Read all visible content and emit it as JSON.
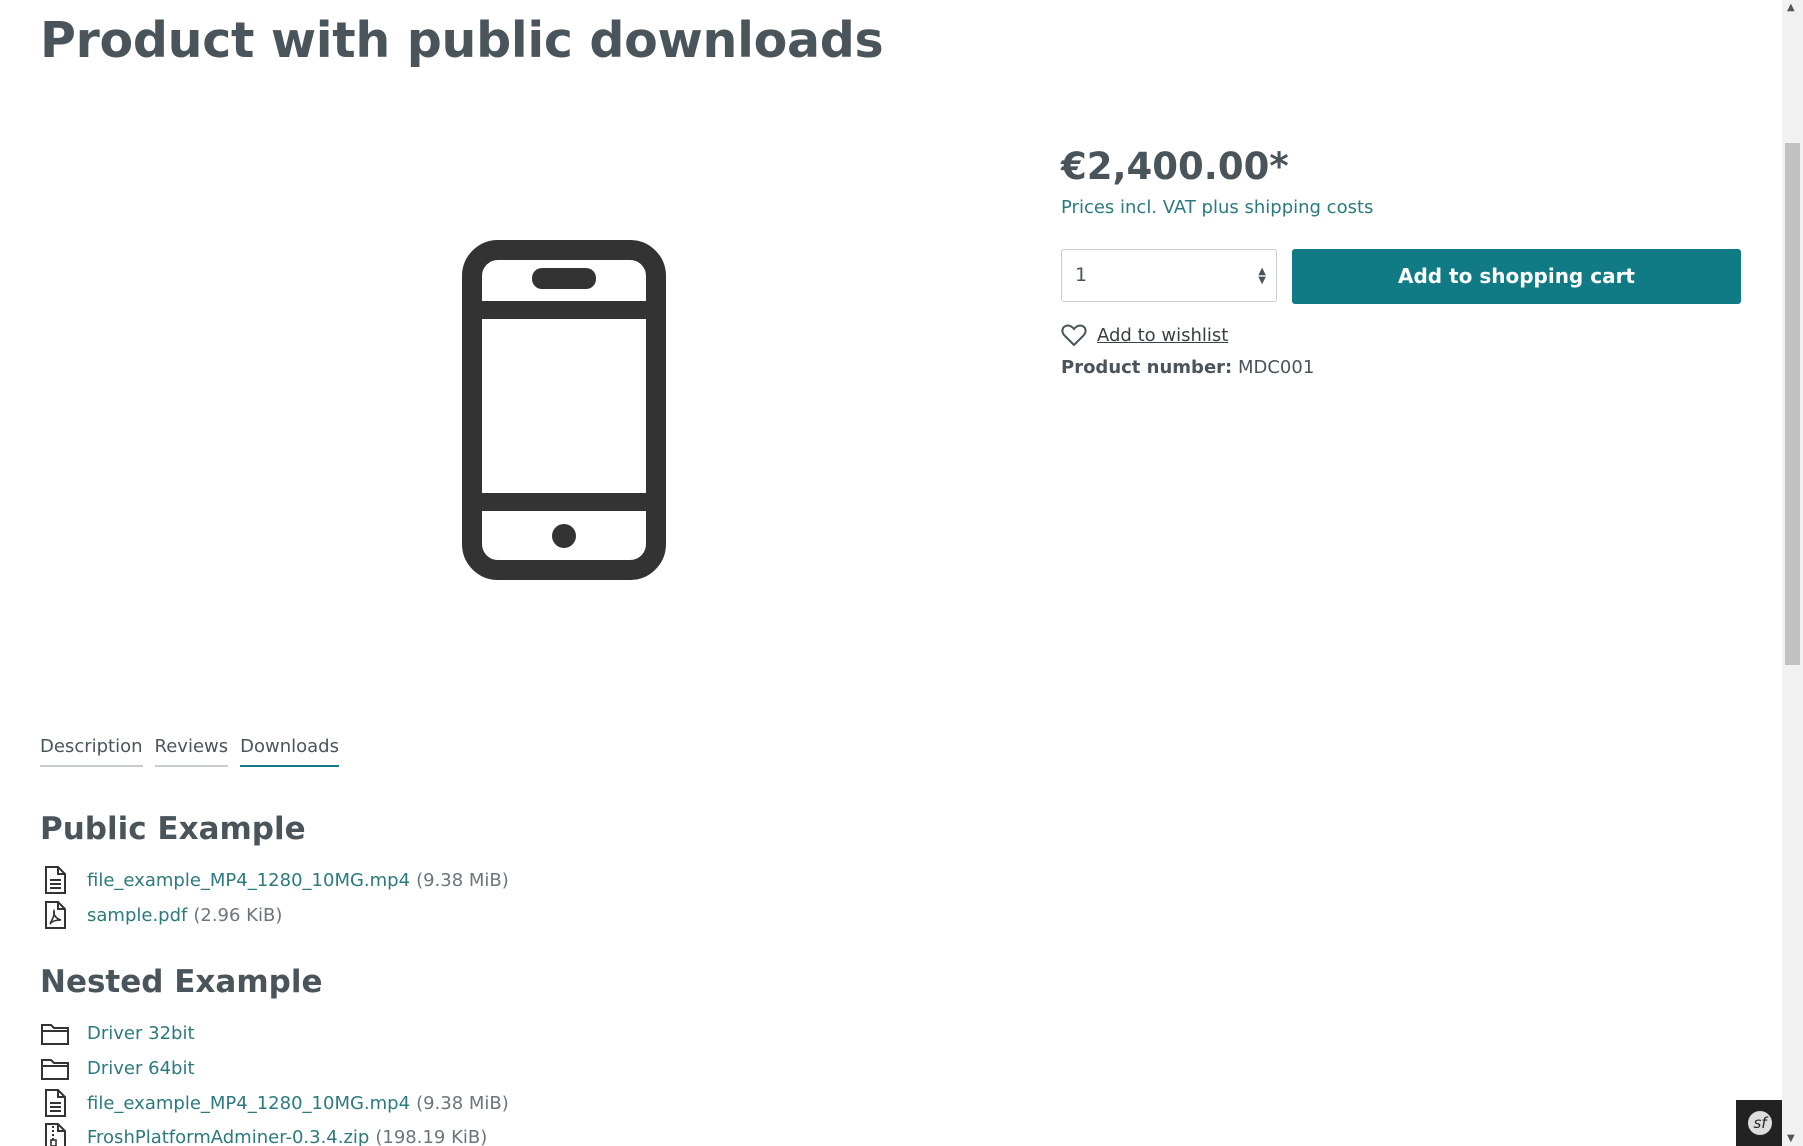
{
  "product": {
    "title": "Product with public downloads",
    "image_icon": "smartphone-icon"
  },
  "buybox": {
    "price": "€2,400.00*",
    "tax_note": "Prices incl. VAT plus shipping costs",
    "quantity": "1",
    "add_to_cart": "Add to shopping cart",
    "wishlist": "Add to wishlist",
    "product_number_label": "Product number:",
    "product_number": "MDC001"
  },
  "tabs": [
    {
      "label": "Description",
      "active": false
    },
    {
      "label": "Reviews",
      "active": false
    },
    {
      "label": "Downloads",
      "active": true
    }
  ],
  "downloads": {
    "public": {
      "heading": "Public Example",
      "items": [
        {
          "icon": "document-icon",
          "name": "file_example_MP4_1280_10MG.mp4",
          "size": "(9.38 MiB)"
        },
        {
          "icon": "pdf-file-icon",
          "name": "sample.pdf",
          "size": "(2.96 KiB)"
        }
      ]
    },
    "nested": {
      "heading": "Nested Example",
      "items": [
        {
          "icon": "folder-icon",
          "name": "Driver 32bit",
          "size": ""
        },
        {
          "icon": "folder-icon",
          "name": "Driver 64bit",
          "size": ""
        },
        {
          "icon": "document-icon",
          "name": "file_example_MP4_1280_10MG.mp4",
          "size": "(9.38 MiB)"
        },
        {
          "icon": "zip-file-icon",
          "name": "FroshPlatformAdminer-0.3.4.zip",
          "size": "(198.19 KiB)"
        }
      ]
    }
  },
  "colors": {
    "accent": "#107b85",
    "link": "#2b7a80",
    "text": "#4a545b"
  }
}
